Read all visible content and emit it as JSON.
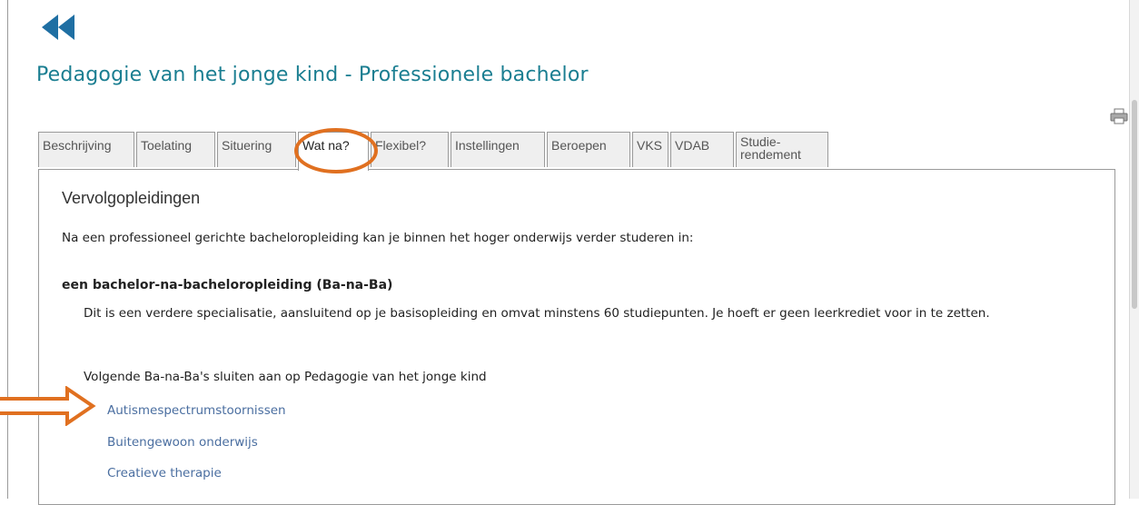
{
  "header": {
    "title": "Pedagogie van het jonge kind - Professionele bachelor",
    "back_icon": "rewind-icon",
    "print_icon": "printer-icon"
  },
  "tabs": [
    {
      "label": "Beschrijving",
      "active": false
    },
    {
      "label": "Toelating",
      "active": false
    },
    {
      "label": "Situering",
      "active": false
    },
    {
      "label": "Wat na?",
      "active": true
    },
    {
      "label": "Flexibel?",
      "active": false
    },
    {
      "label": "Instellingen",
      "active": false
    },
    {
      "label": "Beroepen",
      "active": false
    },
    {
      "label": "VKS",
      "active": false
    },
    {
      "label": "VDAB",
      "active": false
    },
    {
      "label": "Studie-\nrendement",
      "active": false
    }
  ],
  "content": {
    "heading": "Vervolgopleidingen",
    "intro": "Na een professioneel gerichte bacheloropleiding kan je binnen het hoger onderwijs verder studeren in:",
    "subheading": "een bachelor-na-bacheloropleiding (Ba-na-Ba)",
    "description": "Dit is een verdere specialisatie, aansluitend op je basisopleiding en omvat minstens 60 studiepunten. Je hoeft er geen leerkrediet voor in te zetten.",
    "follow_text": "Volgende Ba-na-Ba's sluiten aan op Pedagogie van het jonge kind",
    "links": [
      "Autismespectrumstoornissen",
      "Buitengewoon onderwijs",
      "Creatieve therapie"
    ]
  },
  "colors": {
    "title": "#1a7e91",
    "link": "#4a6ea0",
    "back_icon": "#1f6fa3",
    "annotation": "#e07020"
  }
}
